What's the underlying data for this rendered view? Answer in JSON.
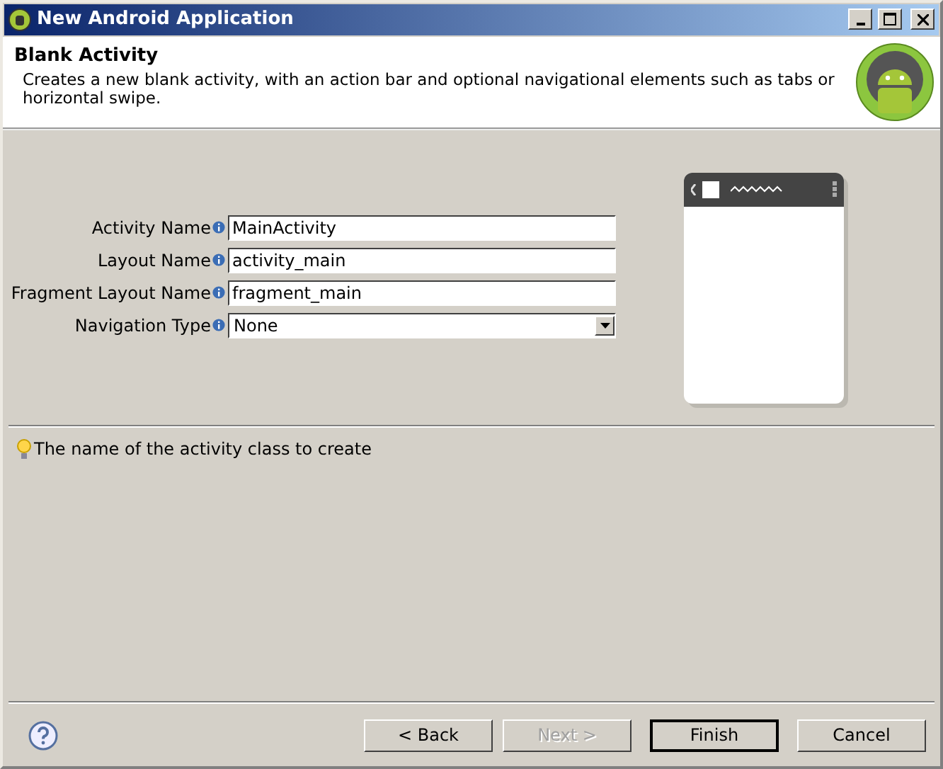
{
  "window": {
    "title": "New Android Application"
  },
  "header": {
    "title": "Blank Activity",
    "description": "Creates a new blank activity, with an action bar and optional navigational elements such as tabs or horizontal swipe."
  },
  "fields": [
    {
      "kind": "text",
      "label": "Activity Name",
      "value": "MainActivity"
    },
    {
      "kind": "text",
      "label": "Layout Name",
      "value": "activity_main"
    },
    {
      "kind": "text",
      "label": "Fragment Layout Name",
      "value": "fragment_main"
    },
    {
      "kind": "select",
      "label": "Navigation Type",
      "value": "None"
    }
  ],
  "hint": "The name of the activity class to create",
  "buttons": [
    {
      "label": "< Back",
      "disabled": false,
      "default": false
    },
    {
      "label": "Next >",
      "disabled": true,
      "default": false
    },
    {
      "label": "Finish",
      "disabled": false,
      "default": true
    },
    {
      "label": "Cancel",
      "disabled": false,
      "default": false
    }
  ]
}
